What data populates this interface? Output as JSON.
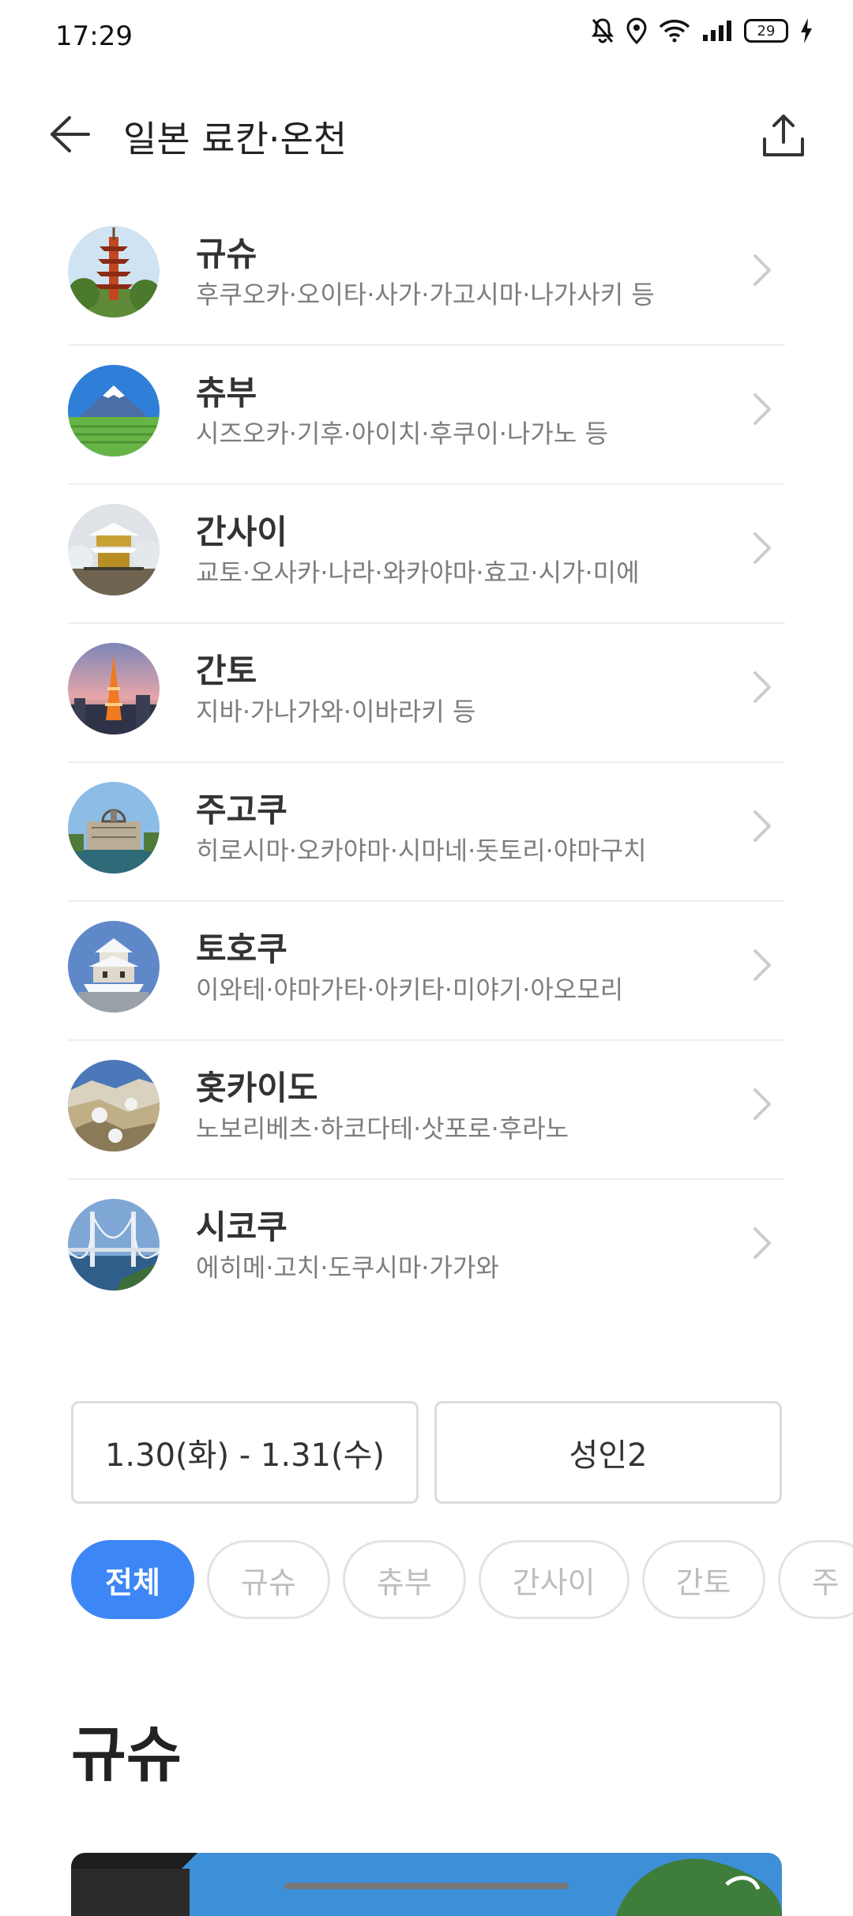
{
  "status_bar": {
    "time": "17:29",
    "battery": "29"
  },
  "header": {
    "title": "일본 료칸·온천"
  },
  "regions": [
    {
      "name": "규슈",
      "desc": "후쿠오카·오이타·사가·가고시마·나가사키 등",
      "icon": "pagoda-thumbnail"
    },
    {
      "name": "츄부",
      "desc": "시즈오카·기후·아이치·후쿠이·나가노 등",
      "icon": "mount-fuji-thumbnail"
    },
    {
      "name": "간사이",
      "desc": "교토·오사카·나라·와카야마·효고·시가·미에",
      "icon": "golden-pavilion-thumbnail"
    },
    {
      "name": "간토",
      "desc": "지바·가나가와·이바라키 등",
      "icon": "tokyo-tower-thumbnail"
    },
    {
      "name": "주고쿠",
      "desc": "히로시마·오카야마·시마네·돗토리·야마구치",
      "icon": "atomic-dome-thumbnail"
    },
    {
      "name": "토호쿠",
      "desc": "이와테·야마가타·아키타·미야기·아오모리",
      "icon": "snow-castle-thumbnail"
    },
    {
      "name": "홋카이도",
      "desc": "노보리베츠·하코다테·삿포로·후라노",
      "icon": "hell-valley-thumbnail"
    },
    {
      "name": "시코쿠",
      "desc": "에히메·고치·도쿠시마·가가와",
      "icon": "bridge-thumbnail"
    }
  ],
  "search": {
    "dates": "1.30(화) - 1.31(수)",
    "guests": "성인2"
  },
  "filter_chips": [
    "전체",
    "규슈",
    "츄부",
    "간사이",
    "간토",
    "주"
  ],
  "section": {
    "title": "규슈"
  },
  "colors": {
    "accent": "#3d86f5",
    "divider": "#eeeeee",
    "subtext": "#7d7d7d"
  }
}
